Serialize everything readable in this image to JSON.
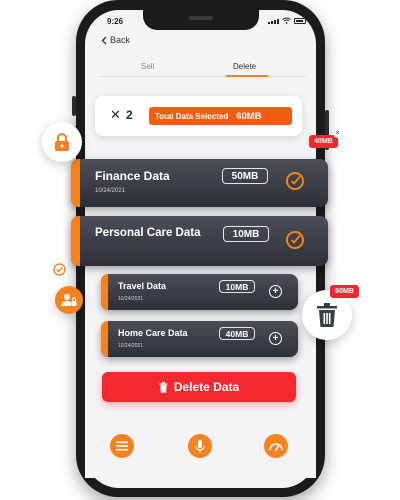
{
  "status_bar": {
    "time": "9:26"
  },
  "nav": {
    "back_label": "Back"
  },
  "tabs": [
    {
      "label": "Sell",
      "active": false
    },
    {
      "label": "Delete",
      "active": true
    }
  ],
  "selection": {
    "count": "2",
    "label": "Total Data Selected",
    "total_size": "60MB"
  },
  "data_items": [
    {
      "title": "Finance Data",
      "date": "10/24/2021",
      "size": "50MB",
      "selected": true
    },
    {
      "title": "Personal Care Data",
      "date": "",
      "size": "10MB",
      "selected": true
    },
    {
      "title": "Travel Data",
      "date": "10/24/2021",
      "size": "10MB",
      "selected": false
    },
    {
      "title": "Home Care Data",
      "date": "10/24/2021",
      "size": "40MB",
      "selected": false
    }
  ],
  "delete_button_label": "Delete Data",
  "floating_badges": {
    "top_right": "40MB",
    "trash": "60MB"
  },
  "bottom_nav": [
    {
      "icon": "menu-icon"
    },
    {
      "icon": "microphone-icon"
    },
    {
      "icon": "speedometer-icon"
    }
  ],
  "colors": {
    "accent": "#f5821f",
    "danger": "#f4282f",
    "card_dark": "#2c3037",
    "pill": "#f35d13"
  }
}
